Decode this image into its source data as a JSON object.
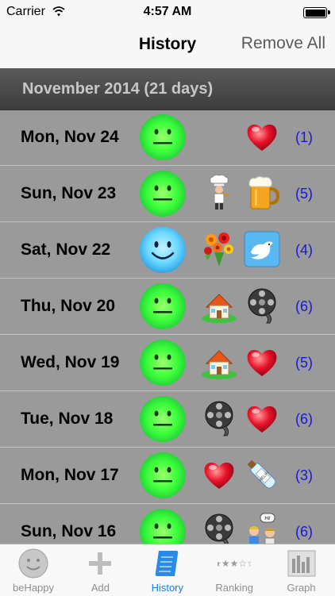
{
  "status_bar": {
    "carrier": "Carrier",
    "time": "4:57 AM"
  },
  "nav": {
    "title": "History",
    "remove_all": "Remove All"
  },
  "section": {
    "title": "November 2014 (21 days)"
  },
  "rows": [
    {
      "date": "Mon, Nov 24",
      "mood": "neutral-green",
      "icons": [
        "heart-icon"
      ],
      "count": "(1)"
    },
    {
      "date": "Sun, Nov 23",
      "mood": "neutral-green",
      "icons": [
        "chef-icon",
        "beer-mug-icon"
      ],
      "count": "(5)"
    },
    {
      "date": "Sat, Nov 22",
      "mood": "smile-blue",
      "icons": [
        "flower-bouquet-icon",
        "twitter-bird-icon"
      ],
      "count": "(4)"
    },
    {
      "date": "Thu, Nov 20",
      "mood": "neutral-green",
      "icons": [
        "house-icon",
        "film-reel-icon"
      ],
      "count": "(6)"
    },
    {
      "date": "Wed, Nov 19",
      "mood": "neutral-green",
      "icons": [
        "house-icon",
        "heart-icon"
      ],
      "count": "(5)"
    },
    {
      "date": "Tue, Nov 18",
      "mood": "neutral-green",
      "icons": [
        "film-reel-icon",
        "heart-icon"
      ],
      "count": "(6)"
    },
    {
      "date": "Mon, Nov 17",
      "mood": "neutral-green",
      "icons": [
        "heart-icon",
        "message-bottle-icon"
      ],
      "count": "(3)"
    },
    {
      "date": "Sun, Nov 16",
      "mood": "neutral-green",
      "icons": [
        "film-reel-icon",
        "friends-hi-icon"
      ],
      "count": "(6)"
    }
  ],
  "icon_text": {
    "bottle": "HELP!",
    "speech": "Hi!"
  },
  "tabs": [
    {
      "label": "beHappy",
      "icon": "smiley-icon",
      "active": false
    },
    {
      "label": "Add",
      "icon": "plus-icon",
      "active": false
    },
    {
      "label": "History",
      "icon": "scroll-icon",
      "active": true
    },
    {
      "label": "Ranking",
      "icon": "stars-icon",
      "active": false
    },
    {
      "label": "Graph",
      "icon": "bar-graph-icon",
      "active": false
    }
  ],
  "colors": {
    "accent": "#1a7fe6",
    "count": "#1818d8",
    "background": "#9a9a9a"
  }
}
